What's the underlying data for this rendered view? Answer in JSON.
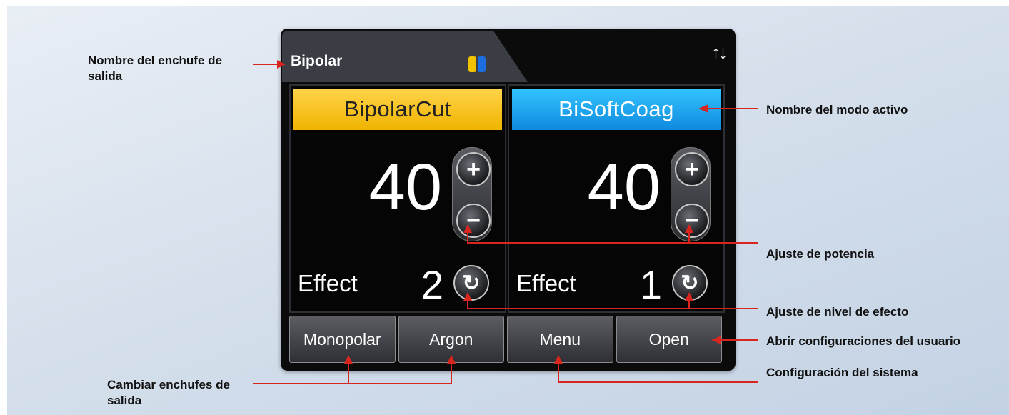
{
  "device": {
    "socket_name": "Bipolar",
    "left_panel": {
      "mode_name": "BipolarCut",
      "power": "40",
      "effect_label": "Effect",
      "effect_value": "2"
    },
    "right_panel": {
      "mode_name": "BiSoftCoag",
      "power": "40",
      "effect_label": "Effect",
      "effect_value": "1"
    },
    "buttons": [
      "Monopolar",
      "Argon",
      "Menu",
      "Open"
    ],
    "icons": {
      "socket_indicator": "bipolar-socket-icon",
      "swap": "updown-arrows-icon",
      "increase": "plus-icon",
      "decrease": "minus-icon",
      "effect_cycle": "cycle-icon"
    }
  },
  "callouts": {
    "socket_name": "Nombre del enchufe de salida",
    "active_mode": "Nombre del modo activo",
    "power_setting": "Ajuste de potencia",
    "effect_setting": "Ajuste de nivel de efecto",
    "user_settings": "Abrir configuraciones del usuario",
    "change_sockets": "Cambiar enchufes de salida",
    "system_config": "Configuración del sistema"
  },
  "colors": {
    "cut_yellow": "#f0b400",
    "coag_blue": "#0f89de",
    "callout_red": "#d8261e"
  }
}
